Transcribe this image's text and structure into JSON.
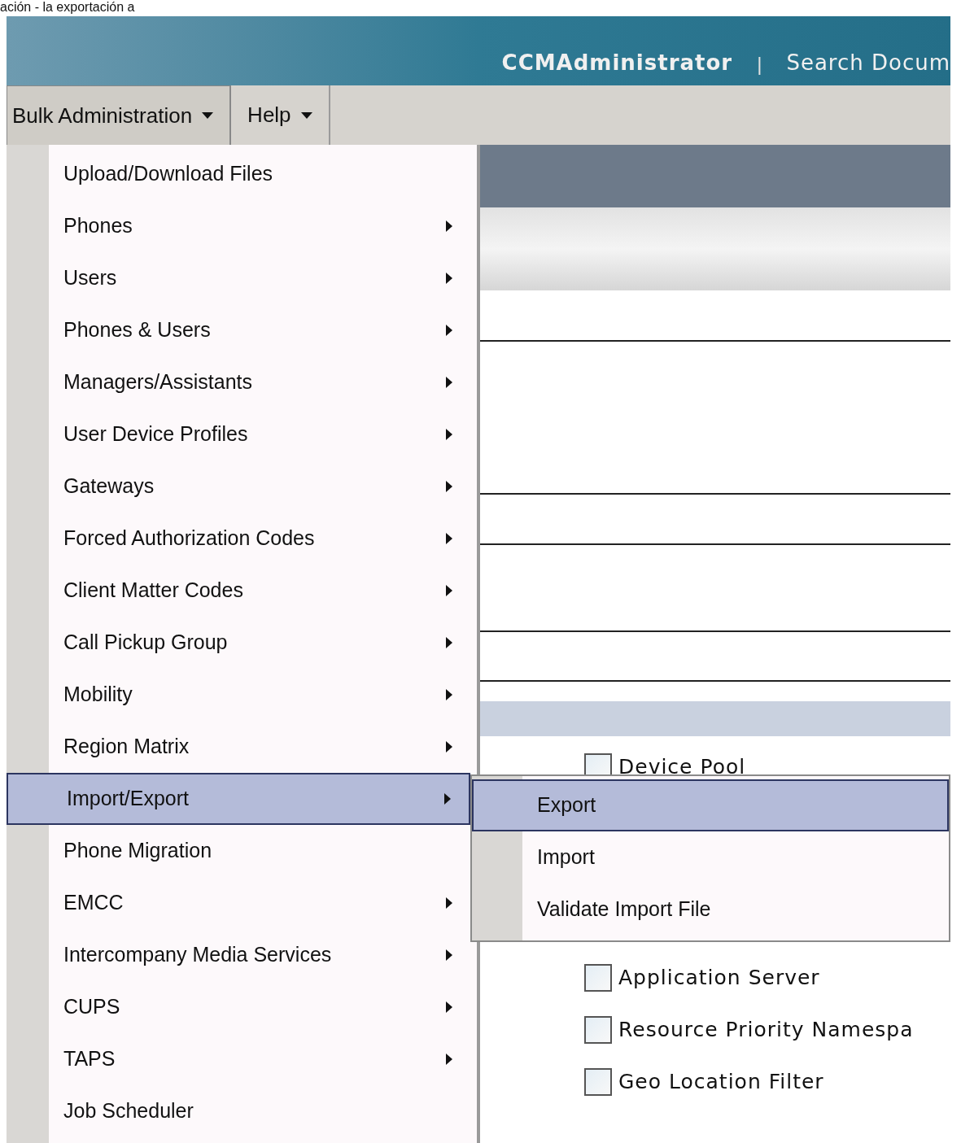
{
  "caption": "ación - la exportación a",
  "header": {
    "user": "CCMAdministrator",
    "separator": "|",
    "link": "Search Docum"
  },
  "nav": {
    "menus": [
      {
        "label": "Bulk Administration",
        "open": true
      },
      {
        "label": "Help",
        "open": false
      }
    ]
  },
  "menu": {
    "items": [
      {
        "label": "Upload/Download Files",
        "has_submenu": false,
        "selected": false
      },
      {
        "label": "Phones",
        "has_submenu": true,
        "selected": false
      },
      {
        "label": "Users",
        "has_submenu": true,
        "selected": false
      },
      {
        "label": "Phones & Users",
        "has_submenu": true,
        "selected": false
      },
      {
        "label": "Managers/Assistants",
        "has_submenu": true,
        "selected": false
      },
      {
        "label": "User Device Profiles",
        "has_submenu": true,
        "selected": false
      },
      {
        "label": "Gateways",
        "has_submenu": true,
        "selected": false
      },
      {
        "label": "Forced Authorization Codes",
        "has_submenu": true,
        "selected": false
      },
      {
        "label": "Client Matter Codes",
        "has_submenu": true,
        "selected": false
      },
      {
        "label": "Call Pickup Group",
        "has_submenu": true,
        "selected": false
      },
      {
        "label": "Mobility",
        "has_submenu": true,
        "selected": false
      },
      {
        "label": "Region Matrix",
        "has_submenu": true,
        "selected": false
      },
      {
        "label": "Import/Export",
        "has_submenu": true,
        "selected": true
      },
      {
        "label": "Phone Migration",
        "has_submenu": false,
        "selected": false
      },
      {
        "label": "EMCC",
        "has_submenu": true,
        "selected": false
      },
      {
        "label": "Intercompany Media Services",
        "has_submenu": true,
        "selected": false
      },
      {
        "label": "CUPS",
        "has_submenu": true,
        "selected": false
      },
      {
        "label": "TAPS",
        "has_submenu": true,
        "selected": false
      },
      {
        "label": "Job Scheduler",
        "has_submenu": false,
        "selected": false
      }
    ]
  },
  "submenu": {
    "items": [
      {
        "label": "Export",
        "selected": true
      },
      {
        "label": "Import",
        "selected": false
      },
      {
        "label": "Validate Import File",
        "selected": false
      }
    ]
  },
  "content": {
    "checkboxes": [
      {
        "label": "Device Pool",
        "checked": false
      },
      {
        "label": "Application Server",
        "checked": false
      },
      {
        "label": "Resource Priority Namespa",
        "checked": false
      },
      {
        "label": "Geo Location Filter",
        "checked": false
      }
    ]
  }
}
